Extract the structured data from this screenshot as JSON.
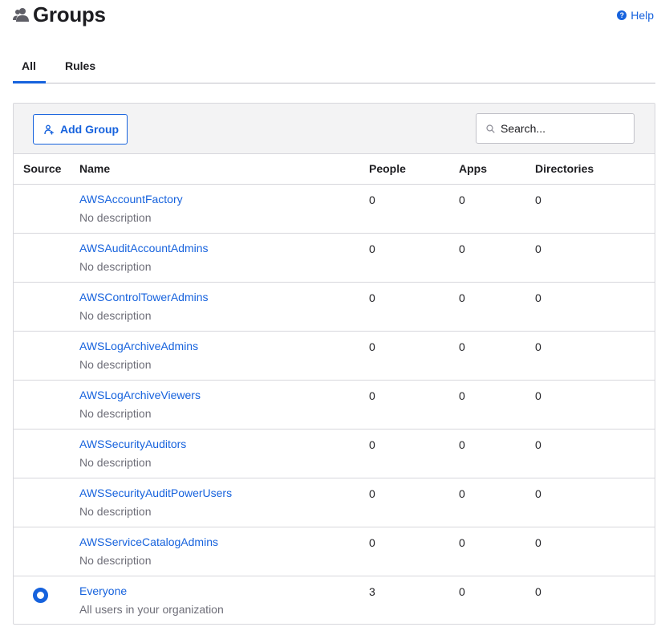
{
  "header": {
    "title": "Groups",
    "help_label": "Help",
    "title_icon": "groups-icon"
  },
  "tabs": [
    {
      "label": "All",
      "active": true
    },
    {
      "label": "Rules",
      "active": false
    }
  ],
  "toolbar": {
    "add_group_label": "Add Group",
    "search_placeholder": "Search...",
    "search_value": ""
  },
  "table": {
    "columns": [
      "Source",
      "Name",
      "People",
      "Apps",
      "Directories"
    ],
    "rows": [
      {
        "source": "",
        "name": "AWSAccountFactory",
        "description": "No description",
        "people": "0",
        "apps": "0",
        "directories": "0"
      },
      {
        "source": "",
        "name": "AWSAuditAccountAdmins",
        "description": "No description",
        "people": "0",
        "apps": "0",
        "directories": "0"
      },
      {
        "source": "",
        "name": "AWSControlTowerAdmins",
        "description": "No description",
        "people": "0",
        "apps": "0",
        "directories": "0"
      },
      {
        "source": "",
        "name": "AWSLogArchiveAdmins",
        "description": "No description",
        "people": "0",
        "apps": "0",
        "directories": "0"
      },
      {
        "source": "",
        "name": "AWSLogArchiveViewers",
        "description": "No description",
        "people": "0",
        "apps": "0",
        "directories": "0"
      },
      {
        "source": "",
        "name": "AWSSecurityAuditors",
        "description": "No description",
        "people": "0",
        "apps": "0",
        "directories": "0"
      },
      {
        "source": "",
        "name": "AWSSecurityAuditPowerUsers",
        "description": "No description",
        "people": "0",
        "apps": "0",
        "directories": "0"
      },
      {
        "source": "",
        "name": "AWSServiceCatalogAdmins",
        "description": "No description",
        "people": "0",
        "apps": "0",
        "directories": "0"
      },
      {
        "source": "okta-ring-icon",
        "name": "Everyone",
        "description": "All users in your organization",
        "people": "3",
        "apps": "0",
        "directories": "0"
      }
    ]
  },
  "colors": {
    "accent": "#1662dd",
    "muted_text": "#6e6e78",
    "toolbar_bg": "#f3f3f4",
    "border": "#d7d7dc"
  }
}
